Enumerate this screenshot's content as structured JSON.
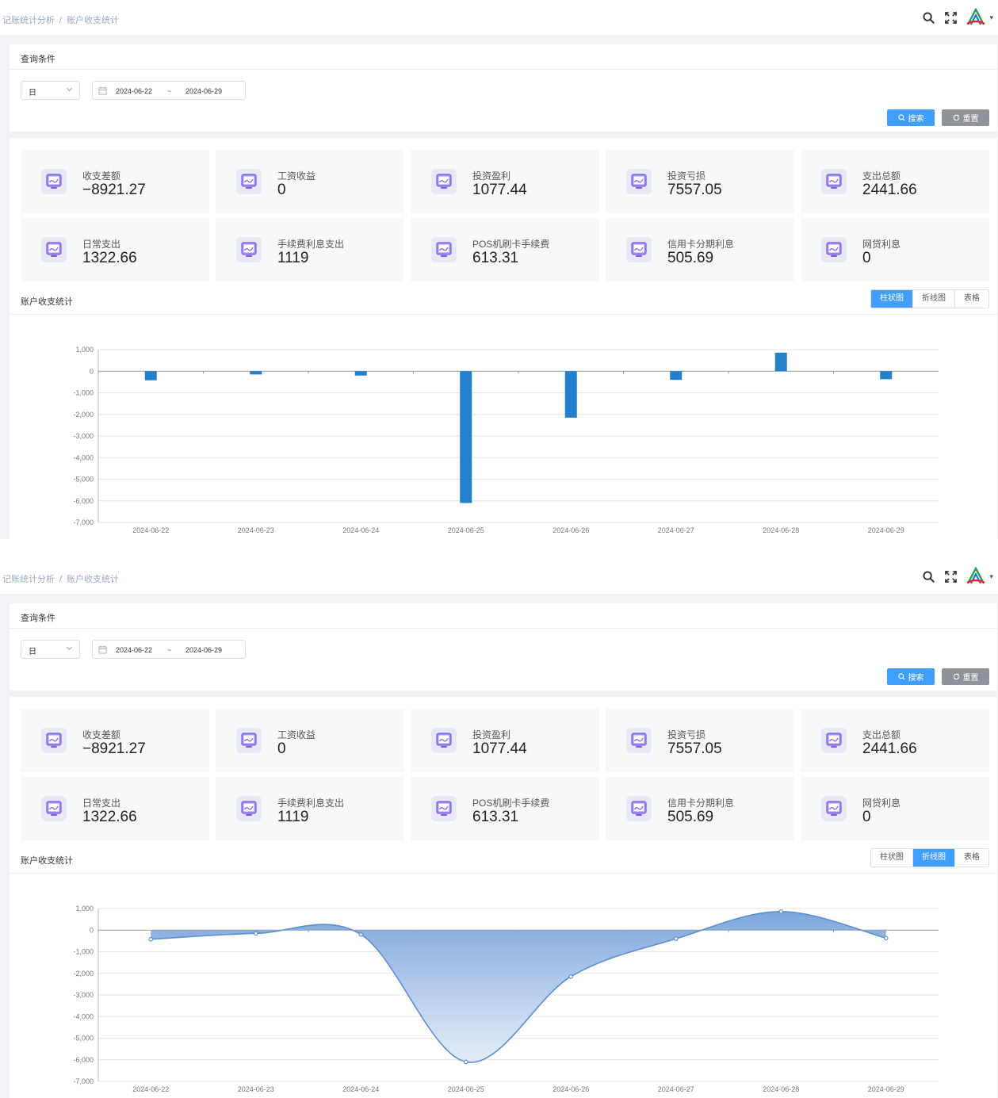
{
  "breadcrumb": {
    "parent": "记账统计分析",
    "sep": "/",
    "current": "账户收支统计"
  },
  "query": {
    "title": "查询条件",
    "granularity": "日",
    "start_date": "2024-06-22",
    "range_sep": "~",
    "end_date": "2024-06-29",
    "search_label": "搜索",
    "reset_label": "重置"
  },
  "stats": [
    {
      "label": "收支差额",
      "value": "−8921.27"
    },
    {
      "label": "工资收益",
      "value": "0"
    },
    {
      "label": "投资盈利",
      "value": "1077.44"
    },
    {
      "label": "投资亏损",
      "value": "7557.05"
    },
    {
      "label": "支出总额",
      "value": "2441.66"
    },
    {
      "label": "日常支出",
      "value": "1322.66"
    },
    {
      "label": "手续费利息支出",
      "value": "1119"
    },
    {
      "label": "POS机刷卡手续费",
      "value": "613.31"
    },
    {
      "label": "信用卡分期利息",
      "value": "505.69"
    },
    {
      "label": "网贷利息",
      "value": "0"
    }
  ],
  "section": {
    "title": "账户收支统计",
    "views": [
      "柱状图",
      "折线图",
      "表格"
    ]
  },
  "screens": [
    {
      "active_view": 0
    },
    {
      "active_view": 1
    }
  ],
  "colors": {
    "primary": "#409eff",
    "bar": "#2280cc",
    "line": "#5b8fd0",
    "reset": "#909399"
  },
  "chart_data": [
    {
      "type": "bar",
      "categories": [
        "2024-06-22",
        "2024-06-23",
        "2024-06-24",
        "2024-06-25",
        "2024-06-26",
        "2024-06-27",
        "2024-06-28",
        "2024-06-29"
      ],
      "values": [
        -420,
        -150,
        -200,
        -6100,
        -2150,
        -400,
        860,
        -370
      ],
      "ylim": [
        -7000,
        1000
      ],
      "yticks": [
        "1,000",
        "0",
        "-1,000",
        "-2,000",
        "-3,000",
        "-4,000",
        "-5,000",
        "-6,000",
        "-7,000"
      ],
      "grid": true
    },
    {
      "type": "area",
      "categories": [
        "2024-06-22",
        "2024-06-23",
        "2024-06-24",
        "2024-06-25",
        "2024-06-26",
        "2024-06-27",
        "2024-06-28",
        "2024-06-29"
      ],
      "values": [
        -420,
        -150,
        -200,
        -6100,
        -2150,
        -400,
        860,
        -370
      ],
      "ylim": [
        -7000,
        1000
      ],
      "yticks": [
        "1,000",
        "0",
        "-1,000",
        "-2,000",
        "-3,000",
        "-4,000",
        "-5,000",
        "-6,000",
        "-7,000"
      ],
      "smooth": true,
      "grid": true
    }
  ]
}
